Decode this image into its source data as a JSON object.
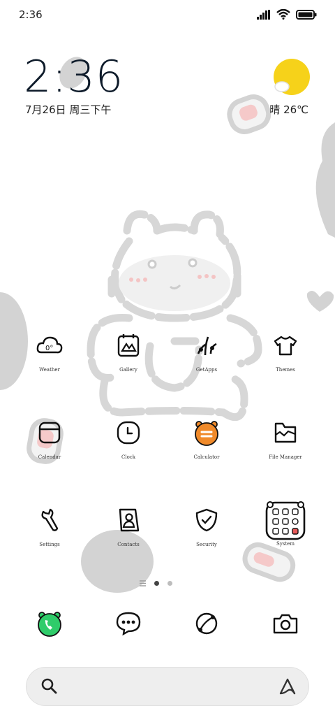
{
  "status": {
    "time": "2:36"
  },
  "widget": {
    "clock": "2:36",
    "date": "7月26日 周三下午",
    "weather": "晴 26℃"
  },
  "apps": [
    {
      "label": "Weather",
      "icon": "weather-icon"
    },
    {
      "label": "Gallery",
      "icon": "gallery-icon"
    },
    {
      "label": "GetApps",
      "icon": "getapps-icon"
    },
    {
      "label": "Themes",
      "icon": "themes-icon"
    },
    {
      "label": "Calendar",
      "icon": "calendar-icon"
    },
    {
      "label": "Clock",
      "icon": "clock-icon"
    },
    {
      "label": "Calculator",
      "icon": "calculator-icon"
    },
    {
      "label": "File Manager",
      "icon": "file-manager-icon"
    },
    {
      "label": "Settings",
      "icon": "settings-icon"
    },
    {
      "label": "Contacts",
      "icon": "contacts-icon"
    },
    {
      "label": "Security",
      "icon": "security-icon"
    },
    {
      "label": "System",
      "icon": "system-folder-icon"
    }
  ],
  "weather_icon_text": "0°",
  "dock": [
    "phone-icon",
    "messages-icon",
    "browser-icon",
    "camera-icon"
  ],
  "colors": {
    "sun": "#f6d21a",
    "calculator": "#f08a2a",
    "phone": "#2fcc6a",
    "deco": "#d3d3d3"
  }
}
